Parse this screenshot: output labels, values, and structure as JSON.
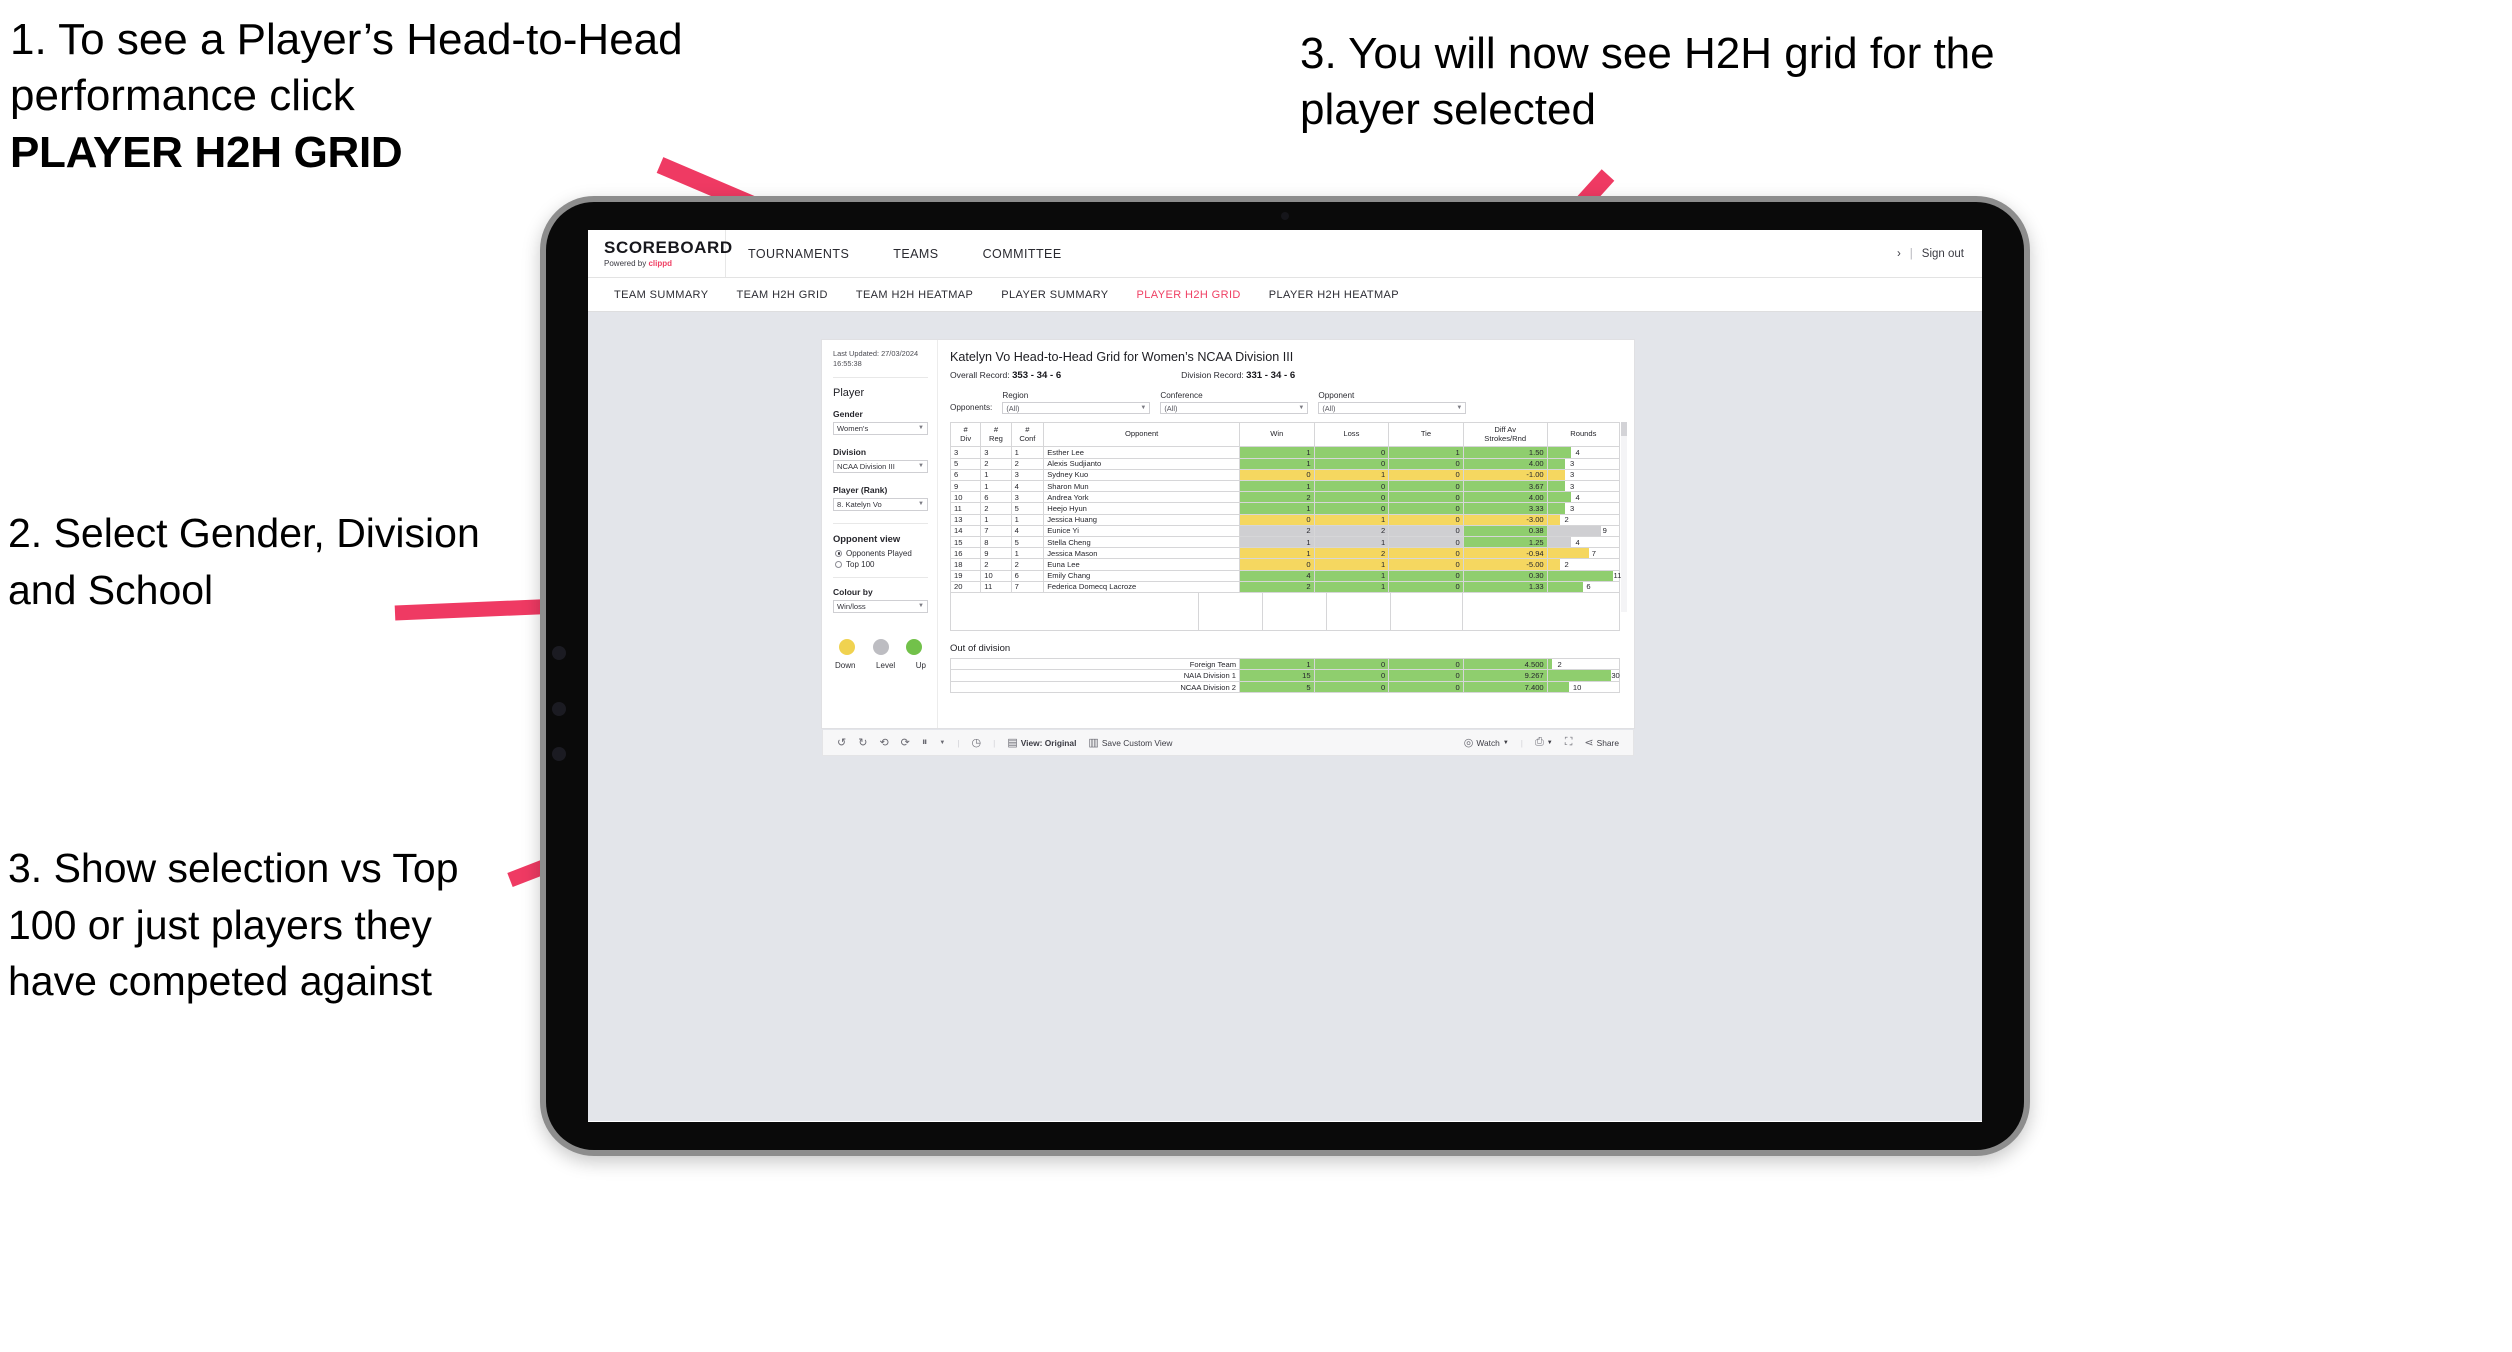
{
  "annotations": {
    "step1_line1": "1. To see a Player’s Head-to-Head performance click ",
    "step1_bold": "PLAYER H2H GRID",
    "step3_top": "3. You will now see H2H grid for the player selected",
    "step2_left": "2. Select Gender, Division and School",
    "step3_left": "3. Show selection vs Top 100 or just players they have competed against",
    "arrow_color": "#ef3a63"
  },
  "app": {
    "brand_title": "SCOREBOARD",
    "brand_sub_prefix": "Powered by ",
    "brand_sub_name": "clippd",
    "accent_color": "#ef3f63",
    "top_nav": [
      "TOURNAMENTS",
      "TEAMS",
      "COMMITTEE"
    ],
    "account_chevron": "›",
    "account_sep": "|",
    "sign_out": "Sign out",
    "sub_nav": [
      {
        "label": "TEAM SUMMARY",
        "active": false
      },
      {
        "label": "TEAM H2H GRID",
        "active": false
      },
      {
        "label": "TEAM H2H HEATMAP",
        "active": false
      },
      {
        "label": "PLAYER SUMMARY",
        "active": false
      },
      {
        "label": "PLAYER H2H GRID",
        "active": true
      },
      {
        "label": "PLAYER H2H HEATMAP",
        "active": false
      }
    ]
  },
  "filters": {
    "last_updated": "Last Updated: 27/03/2024 16:55:38",
    "section_title": "Player",
    "gender_label": "Gender",
    "gender_value": "Women's",
    "division_label": "Division",
    "division_value": "NCAA Division III",
    "player_label": "Player (Rank)",
    "player_value": "8. Katelyn Vo",
    "opponent_view_title": "Opponent view",
    "opponent_view_options": [
      {
        "label": "Opponents Played",
        "selected": true
      },
      {
        "label": "Top 100",
        "selected": false
      }
    ],
    "colour_by_label": "Colour by",
    "colour_by_value": "Win/loss",
    "legend": [
      {
        "label": "Down",
        "color": "#f0d250"
      },
      {
        "label": "Level",
        "color": "#bdbdc2"
      },
      {
        "label": "Up",
        "color": "#72c14a"
      }
    ]
  },
  "viz": {
    "title": "Katelyn Vo Head-to-Head Grid for Women’s NCAA Division III",
    "overall_record_label": "Overall Record: ",
    "overall_record_value": "353 -  34 - 6",
    "division_record_label": "Division Record: ",
    "division_record_value": "331 -  34 - 6",
    "opponents_label": "Opponents:",
    "opponent_filters": [
      {
        "label": "Region",
        "value": "(All)"
      },
      {
        "label": "Conference",
        "value": "(All)"
      },
      {
        "label": "Opponent",
        "value": "(All)"
      }
    ],
    "columns": [
      "# Div",
      "# Reg",
      "# Conf",
      "Opponent",
      "Win",
      "Loss",
      "Tie",
      "Diff Av Strokes/Rnd",
      "Rounds"
    ],
    "rows": [
      {
        "div": "3",
        "reg": "3",
        "conf": "1",
        "opponent": "Esther Lee",
        "win": "1",
        "loss": "0",
        "tie": "1",
        "diff": "1.50",
        "rounds": "4",
        "status": "win"
      },
      {
        "div": "5",
        "reg": "2",
        "conf": "2",
        "opponent": "Alexis Sudjianto",
        "win": "1",
        "loss": "0",
        "tie": "0",
        "diff": "4.00",
        "rounds": "3",
        "status": "win"
      },
      {
        "div": "6",
        "reg": "1",
        "conf": "3",
        "opponent": "Sydney Kuo",
        "win": "0",
        "loss": "1",
        "tie": "0",
        "diff": "-1.00",
        "rounds": "3",
        "status": "loss"
      },
      {
        "div": "9",
        "reg": "1",
        "conf": "4",
        "opponent": "Sharon Mun",
        "win": "1",
        "loss": "0",
        "tie": "0",
        "diff": "3.67",
        "rounds": "3",
        "status": "win"
      },
      {
        "div": "10",
        "reg": "6",
        "conf": "3",
        "opponent": "Andrea York",
        "win": "2",
        "loss": "0",
        "tie": "0",
        "diff": "4.00",
        "rounds": "4",
        "status": "win"
      },
      {
        "div": "11",
        "reg": "2",
        "conf": "5",
        "opponent": "Heejo Hyun",
        "win": "1",
        "loss": "0",
        "tie": "0",
        "diff": "3.33",
        "rounds": "3",
        "status": "win"
      },
      {
        "div": "13",
        "reg": "1",
        "conf": "1",
        "opponent": "Jessica Huang",
        "win": "0",
        "loss": "1",
        "tie": "0",
        "diff": "-3.00",
        "rounds": "2",
        "status": "loss"
      },
      {
        "div": "14",
        "reg": "7",
        "conf": "4",
        "opponent": "Eunice Yi",
        "win": "2",
        "loss": "2",
        "tie": "0",
        "diff": "0.38",
        "rounds": "9",
        "status": "tie",
        "diff_status": "win"
      },
      {
        "div": "15",
        "reg": "8",
        "conf": "5",
        "opponent": "Stella Cheng",
        "win": "1",
        "loss": "1",
        "tie": "0",
        "diff": "1.25",
        "rounds": "4",
        "status": "tie",
        "diff_status": "win"
      },
      {
        "div": "16",
        "reg": "9",
        "conf": "1",
        "opponent": "Jessica Mason",
        "win": "1",
        "loss": "2",
        "tie": "0",
        "diff": "-0.94",
        "rounds": "7",
        "status": "loss"
      },
      {
        "div": "18",
        "reg": "2",
        "conf": "2",
        "opponent": "Euna Lee",
        "win": "0",
        "loss": "1",
        "tie": "0",
        "diff": "-5.00",
        "rounds": "2",
        "status": "loss"
      },
      {
        "div": "19",
        "reg": "10",
        "conf": "6",
        "opponent": "Emily Chang",
        "win": "4",
        "loss": "1",
        "tie": "0",
        "diff": "0.30",
        "rounds": "11",
        "status": "win"
      },
      {
        "div": "20",
        "reg": "11",
        "conf": "7",
        "opponent": "Federica Domecq Lacroze",
        "win": "2",
        "loss": "1",
        "tie": "0",
        "diff": "1.33",
        "rounds": "6",
        "status": "win"
      }
    ],
    "out_of_division_title": "Out of division",
    "out_of_division_rows": [
      {
        "name": "Foreign Team",
        "win": "1",
        "loss": "0",
        "tie": "0",
        "diff": "4.500",
        "rounds": "2",
        "status": "win"
      },
      {
        "name": "NAIA Division 1",
        "win": "15",
        "loss": "0",
        "tie": "0",
        "diff": "9.267",
        "rounds": "30",
        "status": "win"
      },
      {
        "name": "NCAA Division 2",
        "win": "5",
        "loss": "0",
        "tie": "0",
        "diff": "7.400",
        "rounds": "10",
        "status": "win"
      }
    ],
    "max_rounds": 12,
    "max_rounds_ood": 34
  },
  "toolbar": {
    "undo": "undo-icon",
    "redo": "redo-icon",
    "revert": "revert-icon",
    "refresh": "refresh-icon",
    "pause": "pause-icon",
    "alerts": "alerts-icon",
    "view_original": "View: Original",
    "save_custom_view": "Save Custom View",
    "watch": "Watch",
    "share": "Share"
  },
  "chart_data": {
    "type": "table",
    "title": "Katelyn Vo Head-to-Head Grid for Women’s NCAA Division III",
    "columns": [
      "# Div",
      "# Reg",
      "# Conf",
      "Opponent",
      "Win",
      "Loss",
      "Tie",
      "Diff Av Strokes/Rnd",
      "Rounds"
    ],
    "values": [
      [
        "3",
        "3",
        "1",
        "Esther Lee",
        1,
        0,
        1,
        1.5,
        4
      ],
      [
        "5",
        "2",
        "2",
        "Alexis Sudjianto",
        1,
        0,
        0,
        4.0,
        3
      ],
      [
        "6",
        "1",
        "3",
        "Sydney Kuo",
        0,
        1,
        0,
        -1.0,
        3
      ],
      [
        "9",
        "1",
        "4",
        "Sharon Mun",
        1,
        0,
        0,
        3.67,
        3
      ],
      [
        "10",
        "6",
        "3",
        "Andrea York",
        2,
        0,
        0,
        4.0,
        4
      ],
      [
        "11",
        "2",
        "5",
        "Heejo Hyun",
        1,
        0,
        0,
        3.33,
        3
      ],
      [
        "13",
        "1",
        "1",
        "Jessica Huang",
        0,
        1,
        0,
        -3.0,
        2
      ],
      [
        "14",
        "7",
        "4",
        "Eunice Yi",
        2,
        2,
        0,
        0.38,
        9
      ],
      [
        "15",
        "8",
        "5",
        "Stella Cheng",
        1,
        1,
        0,
        1.25,
        4
      ],
      [
        "16",
        "9",
        "1",
        "Jessica Mason",
        1,
        2,
        0,
        -0.94,
        7
      ],
      [
        "18",
        "2",
        "2",
        "Euna Lee",
        0,
        1,
        0,
        -5.0,
        2
      ],
      [
        "19",
        "10",
        "6",
        "Emily Chang",
        4,
        1,
        0,
        0.3,
        11
      ],
      [
        "20",
        "11",
        "7",
        "Federica Domecq Lacroze",
        2,
        1,
        0,
        1.33,
        6
      ]
    ],
    "out_of_division": [
      [
        "Foreign Team",
        1,
        0,
        0,
        4.5,
        2
      ],
      [
        "NAIA Division 1",
        15,
        0,
        0,
        9.267,
        30
      ],
      [
        "NCAA Division 2",
        5,
        0,
        0,
        7.4,
        10
      ]
    ],
    "colour_encoding": {
      "up": "#8fce6e",
      "level": "#cfcfd2",
      "down": "#f5d760"
    },
    "legend_position": "left-panel"
  }
}
